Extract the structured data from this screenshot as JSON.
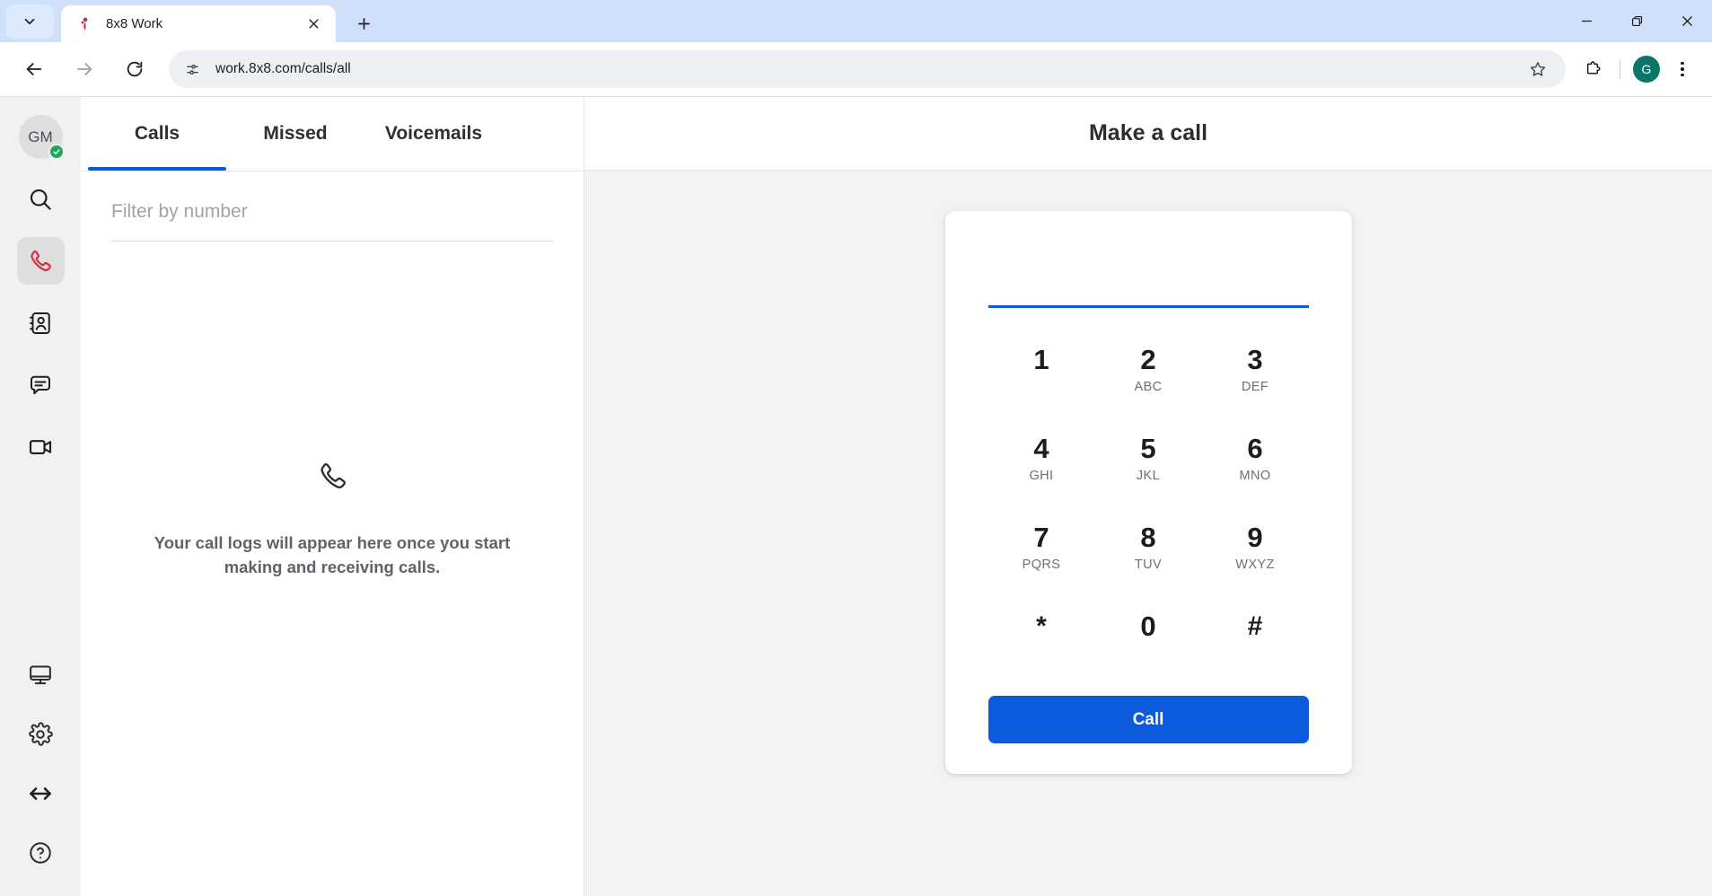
{
  "browser": {
    "tab_search_icon": "chevron-down-icon",
    "tab": {
      "title": "8x8 Work",
      "favicon": "8x8-favicon",
      "close_icon": "close-icon"
    },
    "new_tab_icon": "plus-icon",
    "window": {
      "minimize_icon": "minimize-icon",
      "restore_icon": "restore-icon",
      "close_icon": "close-icon"
    },
    "toolbar": {
      "back_icon": "back-arrow-icon",
      "forward_icon": "forward-arrow-icon",
      "reload_icon": "reload-icon",
      "site_info_icon": "site-settings-icon",
      "url": "work.8x8.com/calls/all",
      "url_placeholder": "Search Google or type a URL",
      "bookmark_icon": "star-icon",
      "extensions_icon": "extensions-puzzle-icon",
      "profile_initial": "G",
      "menu_icon": "three-dot-menu-icon"
    }
  },
  "rail": {
    "avatar_initials": "GM",
    "status_icon": "available-check-icon",
    "items": [
      {
        "name": "search",
        "icon": "search-icon",
        "active": false
      },
      {
        "name": "calls",
        "icon": "phone-icon",
        "active": true
      },
      {
        "name": "contacts",
        "icon": "contacts-book-icon",
        "active": false
      },
      {
        "name": "messages",
        "icon": "chat-bubble-icon",
        "active": false
      },
      {
        "name": "meetings",
        "icon": "video-camera-icon",
        "active": false
      }
    ],
    "bottom_items": [
      {
        "name": "devices",
        "icon": "monitor-icon"
      },
      {
        "name": "settings",
        "icon": "gear-icon"
      },
      {
        "name": "resize",
        "icon": "left-right-arrow-icon"
      },
      {
        "name": "help",
        "icon": "question-mark-circle-icon"
      }
    ]
  },
  "calls_panel": {
    "tabs": [
      {
        "label": "Calls",
        "active": true
      },
      {
        "label": "Missed",
        "active": false
      },
      {
        "label": "Voicemails",
        "active": false
      }
    ],
    "filter": {
      "value": "",
      "placeholder": "Filter by number"
    },
    "empty_state": {
      "icon": "phone-handset-icon",
      "message": "Your call logs will appear here once you start making and receiving calls."
    }
  },
  "dialer": {
    "title": "Make a call",
    "number_input": {
      "value": "",
      "placeholder": ""
    },
    "keys": [
      {
        "digit": "1",
        "letters": ""
      },
      {
        "digit": "2",
        "letters": "ABC"
      },
      {
        "digit": "3",
        "letters": "DEF"
      },
      {
        "digit": "4",
        "letters": "GHI"
      },
      {
        "digit": "5",
        "letters": "JKL"
      },
      {
        "digit": "6",
        "letters": "MNO"
      },
      {
        "digit": "7",
        "letters": "PQRS"
      },
      {
        "digit": "8",
        "letters": "TUV"
      },
      {
        "digit": "9",
        "letters": "WXYZ"
      },
      {
        "digit": "*",
        "letters": ""
      },
      {
        "digit": "0",
        "letters": ""
      },
      {
        "digit": "#",
        "letters": ""
      }
    ],
    "call_button_label": "Call"
  },
  "colors": {
    "accent_blue": "#0d5bdd",
    "brand_red": "#d6293e",
    "chrome_tabstrip": "#cfe0fb",
    "status_green": "#1ea85c",
    "profile_teal": "#0b7567"
  }
}
